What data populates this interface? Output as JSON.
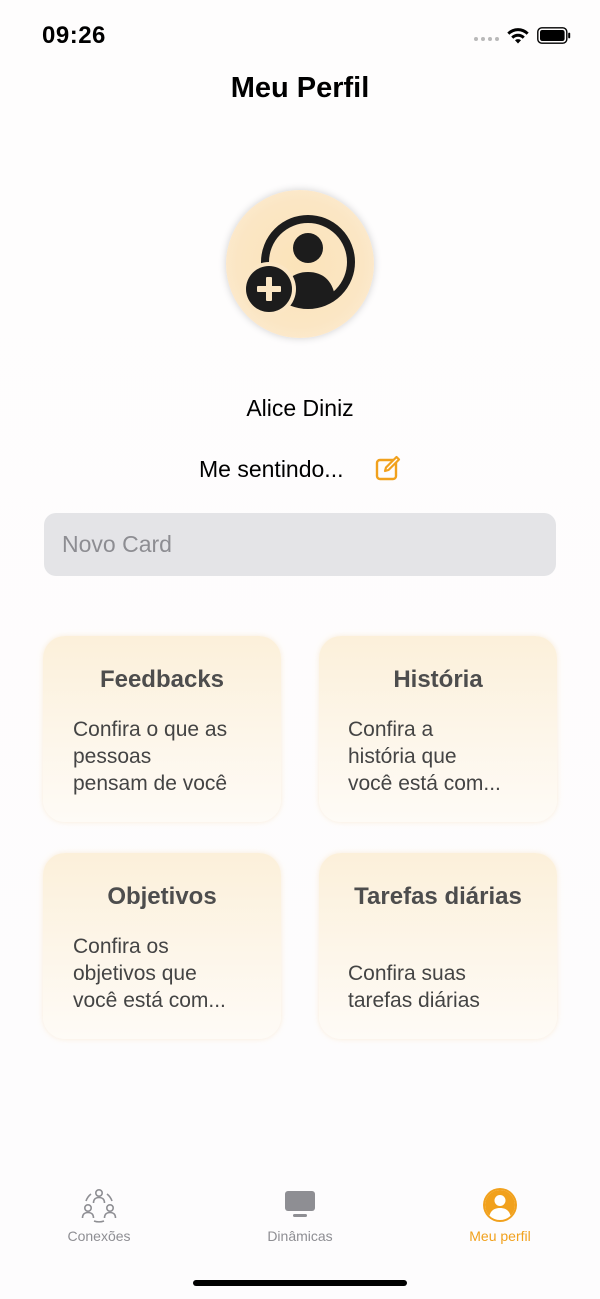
{
  "status_bar": {
    "time": "09:26"
  },
  "header": {
    "title": "Meu Perfil"
  },
  "profile": {
    "name": "Alice Diniz",
    "mood_label": "Me sentindo..."
  },
  "new_card": {
    "placeholder": "Novo Card",
    "value": ""
  },
  "cards": [
    {
      "title": "Feedbacks",
      "description": [
        "Confira o que as",
        "pessoas",
        "pensam de você"
      ]
    },
    {
      "title": "História",
      "description": [
        "Confira a",
        "história que",
        "você está com..."
      ]
    },
    {
      "title": "Objetivos",
      "description": [
        "Confira os",
        "objetivos que",
        "você está com..."
      ]
    },
    {
      "title": "Tarefas diárias",
      "description": [
        "Confira suas",
        "tarefas diárias"
      ]
    }
  ],
  "tab_bar": {
    "items": [
      {
        "label": "Conexões",
        "icon": "connections-icon",
        "active": false
      },
      {
        "label": "Dinâmicas",
        "icon": "screen-icon",
        "active": false
      },
      {
        "label": "Meu perfil",
        "icon": "profile-icon",
        "active": true
      }
    ]
  },
  "colors": {
    "accent": "#f1a11d",
    "inactive": "#8e8e93",
    "card_bg": "#fcf0da",
    "input_bg": "#e4e4e7"
  }
}
